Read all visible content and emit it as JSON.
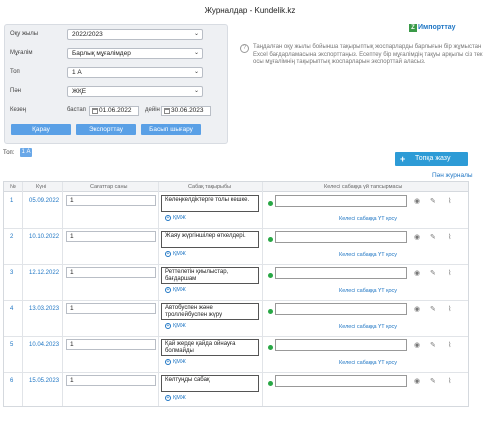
{
  "page": {
    "title": "Журналдар - Kundelik.kz"
  },
  "filters": {
    "year_label": "Оқу жылы",
    "year_value": "2022/2023",
    "teacher_label": "Мұғалім",
    "teacher_value": "Барлық мұғалімдер",
    "group_label": "Топ",
    "group_value": "1 А",
    "subject_label": "Пән",
    "subject_value": "ЖҚЕ",
    "period_label": "Кезең",
    "start_label": "бастап",
    "start_value": "01.06.2022",
    "end_label": "дейін",
    "end_value": "30.06.2023",
    "btn_view": "Қарау",
    "btn_export": "Экспорттау",
    "btn_print": "Басып шығару"
  },
  "import": {
    "link": "Импорттау",
    "icon_glyph": "Z",
    "help_text": "Таңдалған оқу жылы бойынша тақырыптық жоспарларды барлығын бір жұмыстан Excel бағдарламасына экспорттаңыз. Есептеу бір мұғалімдің тақуы арқылы сіз тек осы мұғалімнің тақырыптық жоспарларын экспорттай аласыз."
  },
  "group": {
    "label": "Топ:",
    "badge": "1 А"
  },
  "actions": {
    "add_topic": "Топқа жазу",
    "plan_link": "Пән журналы"
  },
  "table": {
    "headers": {
      "n": "№",
      "date": "Күні",
      "hours": "Сағаттар саны",
      "topic": "Сабақ тақырыбы",
      "hw": "Келесі сабаққа үй тапсырмасы"
    },
    "kmzh_label": "ҚМЖ",
    "hw_link": "Келесі сабаққа ҮТ қосу",
    "rows": [
      {
        "n": "1",
        "date": "05.09.2022",
        "hours": "1",
        "topic": "Көлеңкелдіктерге толы кешке."
      },
      {
        "n": "2",
        "date": "10.10.2022",
        "hours": "1",
        "topic": "Жаяу жүргіншілер өткелдері."
      },
      {
        "n": "3",
        "date": "12.12.2022",
        "hours": "1",
        "topic": "Реттелетін қиылыстар, бағдаршам"
      },
      {
        "n": "4",
        "date": "13.03.2023",
        "hours": "1",
        "topic": "Автобуспен және троллейбуспен жүру"
      },
      {
        "n": "5",
        "date": "10.04.2023",
        "hours": "1",
        "topic": "Қай жерде қайда ойнауға болмайды"
      },
      {
        "n": "6",
        "date": "15.05.2023",
        "hours": "1",
        "topic": "Көлтуңды сабақ"
      }
    ]
  },
  "colors": {
    "link": "#1f76c4",
    "button": "#5aa0e6",
    "add_button": "#2d9bd6",
    "dot": "#28a745"
  }
}
